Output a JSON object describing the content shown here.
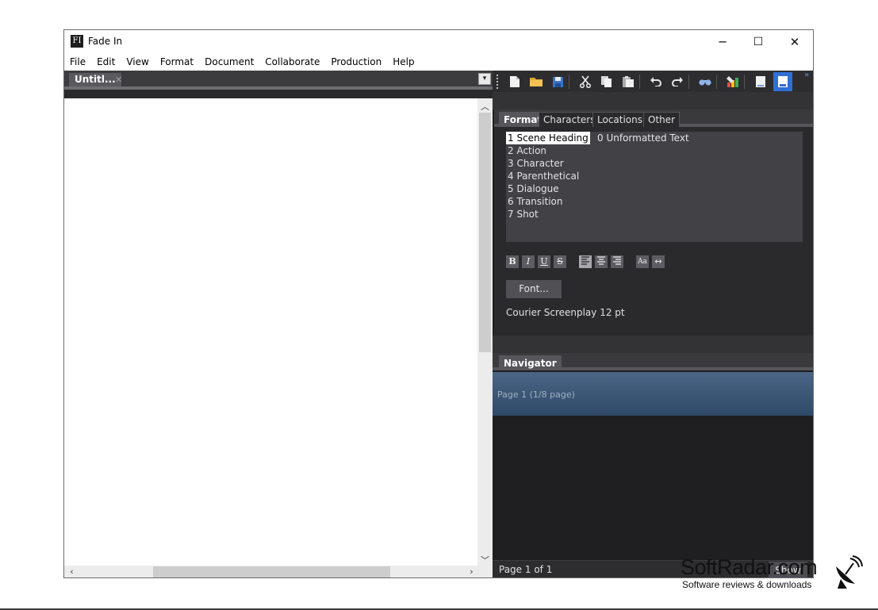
{
  "window": {
    "title": "Fade In",
    "icon_text": "FI",
    "controls": {
      "minimize": "─",
      "maximize": "☐",
      "close": "✕"
    }
  },
  "menu": [
    "File",
    "Edit",
    "View",
    "Format",
    "Document",
    "Collaborate",
    "Production",
    "Help"
  ],
  "document": {
    "tab_label": "Untitl...",
    "tab_close": "✕",
    "dropdown": "▾"
  },
  "toolbar": {
    "icons": [
      "new-document-icon",
      "open-folder-icon",
      "save-icon",
      "cut-icon",
      "copy-icon",
      "paste-icon",
      "undo-icon",
      "redo-icon",
      "find-icon",
      "color-highlight-icon",
      "single-page-view-icon",
      "page-view-icon"
    ],
    "overflow": "»"
  },
  "format_panel": {
    "tabs": [
      "Format",
      "Characters",
      "Locations",
      "Other"
    ],
    "active_tab": "Format",
    "elements": [
      "1 Scene Heading",
      "2 Action",
      "3 Character",
      "4 Parenthetical",
      "5 Dialogue",
      "6 Transition",
      "7 Shot"
    ],
    "unformatted": "0 Unformatted Text",
    "selected_element": "1 Scene Heading",
    "style_buttons": {
      "bold": "B",
      "italic": "I",
      "underline": "U",
      "strike": "S",
      "case": "Aa",
      "width": "↔"
    },
    "font_button": "Font...",
    "font_description": "Courier Screenplay 12 pt"
  },
  "navigator": {
    "tab": "Navigator",
    "page_entry": "Page 1 (1/8 page)"
  },
  "status": {
    "page_of": "Page 1 of 1",
    "show_button": "Show"
  },
  "watermark": {
    "title": "SoftRadar.com",
    "subtitle": "Software reviews & downloads"
  },
  "colors": {
    "dark_bg": "#1f1f22",
    "panel_bg": "#2a2a2d",
    "accent_toolbar": "#2f6fd6",
    "navigator_row": "#3d5878"
  }
}
